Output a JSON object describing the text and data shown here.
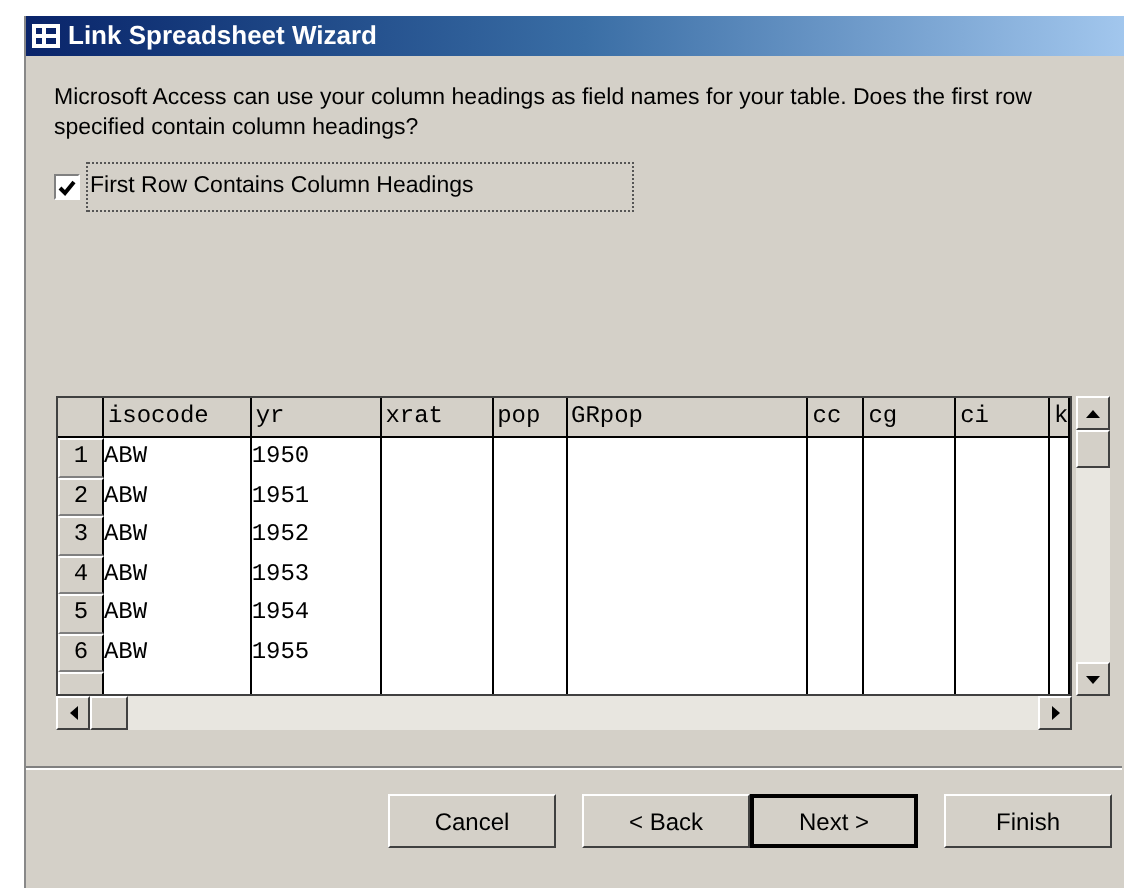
{
  "window": {
    "title": "Link Spreadsheet Wizard"
  },
  "prompt": "Microsoft Access can use your column headings as field names for your table. Does the first row specified contain column headings?",
  "checkbox": {
    "label": "First Row Contains Column Headings",
    "checked": true
  },
  "table": {
    "columns": [
      "isocode",
      "yr",
      "xrat",
      "pop",
      "GRpop",
      "cc",
      "cg",
      "ci",
      "k"
    ],
    "rows": [
      {
        "number": "1",
        "cells": [
          "ABW",
          "1950"
        ]
      },
      {
        "number": "2",
        "cells": [
          "ABW",
          "1951"
        ]
      },
      {
        "number": "3",
        "cells": [
          "ABW",
          "1952"
        ]
      },
      {
        "number": "4",
        "cells": [
          "ABW",
          "1953"
        ]
      },
      {
        "number": "5",
        "cells": [
          "ABW",
          "1954"
        ]
      },
      {
        "number": "6",
        "cells": [
          "ABW",
          "1955"
        ]
      }
    ]
  },
  "buttons": [
    {
      "label": "Cancel",
      "default": false
    },
    {
      "label": "< Back",
      "default": false
    },
    {
      "label": "Next >",
      "default": true
    },
    {
      "label": "Finish",
      "default": false
    }
  ]
}
